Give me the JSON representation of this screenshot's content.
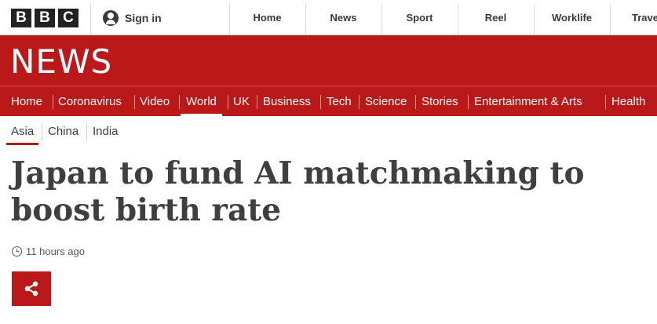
{
  "masthead": {
    "logo_letters": [
      "B",
      "B",
      "C"
    ],
    "signin_label": "Sign in",
    "nav": [
      "Home",
      "News",
      "Sport",
      "Reel",
      "Worklife",
      "Travel"
    ]
  },
  "banner": {
    "title": "NEWS"
  },
  "section_nav": {
    "items": [
      "Home",
      "Coronavirus",
      "Video",
      "World",
      "UK",
      "Business",
      "Tech",
      "Science",
      "Stories",
      "Entertainment & Arts",
      "Health"
    ],
    "active": "World"
  },
  "sub_nav": {
    "items": [
      "Asia",
      "China",
      "India"
    ],
    "active": "Asia"
  },
  "article": {
    "headline_line1": "Japan to fund AI matchmaking to",
    "headline_line2": "boost birth rate",
    "timestamp": "11 hours ago"
  },
  "colors": {
    "brand_red": "#bb1919",
    "text_dark": "#3f3f42"
  },
  "icons": {
    "user": "user-icon",
    "clock": "clock-icon",
    "share": "share-icon"
  }
}
